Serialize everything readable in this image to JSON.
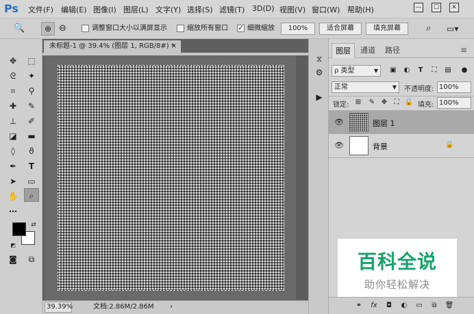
{
  "app": {
    "logo": "Ps"
  },
  "menu": [
    "文件(F)",
    "编辑(E)",
    "图像(I)",
    "图层(L)",
    "文字(Y)",
    "选择(S)",
    "滤镜(T)",
    "3D(D)",
    "视图(V)",
    "窗口(W)",
    "帮助(H)"
  ],
  "window_controls": {
    "minimize": "—",
    "maximize": "☐",
    "close": "✕"
  },
  "options_bar": {
    "zoom_tool_icon": "🔍",
    "zoom_in_icon": "⊕",
    "zoom_out_icon": "⊖",
    "resize_windows_label": "调整窗口大小以满屏显示",
    "resize_windows_checked": false,
    "zoom_all_windows_label": "缩放所有窗口",
    "zoom_all_windows_checked": false,
    "scrubby_zoom_label": "细微缩放",
    "scrubby_zoom_checked": true,
    "actual_pixels_button": "100%",
    "fit_screen_button": "适合屏幕",
    "fill_screen_button": "填充屏幕"
  },
  "document": {
    "tab_title": "未标题-1 @ 39.4% (图层 1, RGB/8#) *",
    "tab_close": "×",
    "zoom": "39.39%",
    "doc_info": "文档:2.86M/2.86M",
    "status_arrow": "›"
  },
  "tools": [
    "move-icon",
    "marquee-icon",
    "lasso-icon",
    "magic-wand-icon",
    "crop-icon",
    "eyedropper-icon",
    "healing-icon",
    "brush-icon",
    "stamp-icon",
    "history-brush-icon",
    "eraser-icon",
    "gradient-icon",
    "blur-icon",
    "dodge-icon",
    "pen-icon",
    "type-icon",
    "path-select-icon",
    "rectangle-icon",
    "hand-icon",
    "zoom-icon"
  ],
  "active_tool": "zoom-icon",
  "colors": {
    "foreground": "#000000",
    "background": "#ffffff",
    "watermark_green": "#18a36a"
  },
  "layers_panel": {
    "tabs": [
      "图层",
      "通道",
      "路径"
    ],
    "active_tab": "图层",
    "kind_filter": "ρ 类型",
    "blend_mode": "正常",
    "opacity_label": "不透明度:",
    "opacity_value": "100%",
    "lock_label": "锁定:",
    "fill_label": "填充:",
    "fill_value": "100%",
    "layers": [
      {
        "name": "图层 1",
        "selected": true,
        "visible": true,
        "thumb": "pattern"
      },
      {
        "name": "背景",
        "selected": false,
        "visible": true,
        "thumb": "white",
        "locked": true
      }
    ]
  },
  "watermark": {
    "title": "百科全说",
    "subtitle": "助你轻松解决"
  }
}
